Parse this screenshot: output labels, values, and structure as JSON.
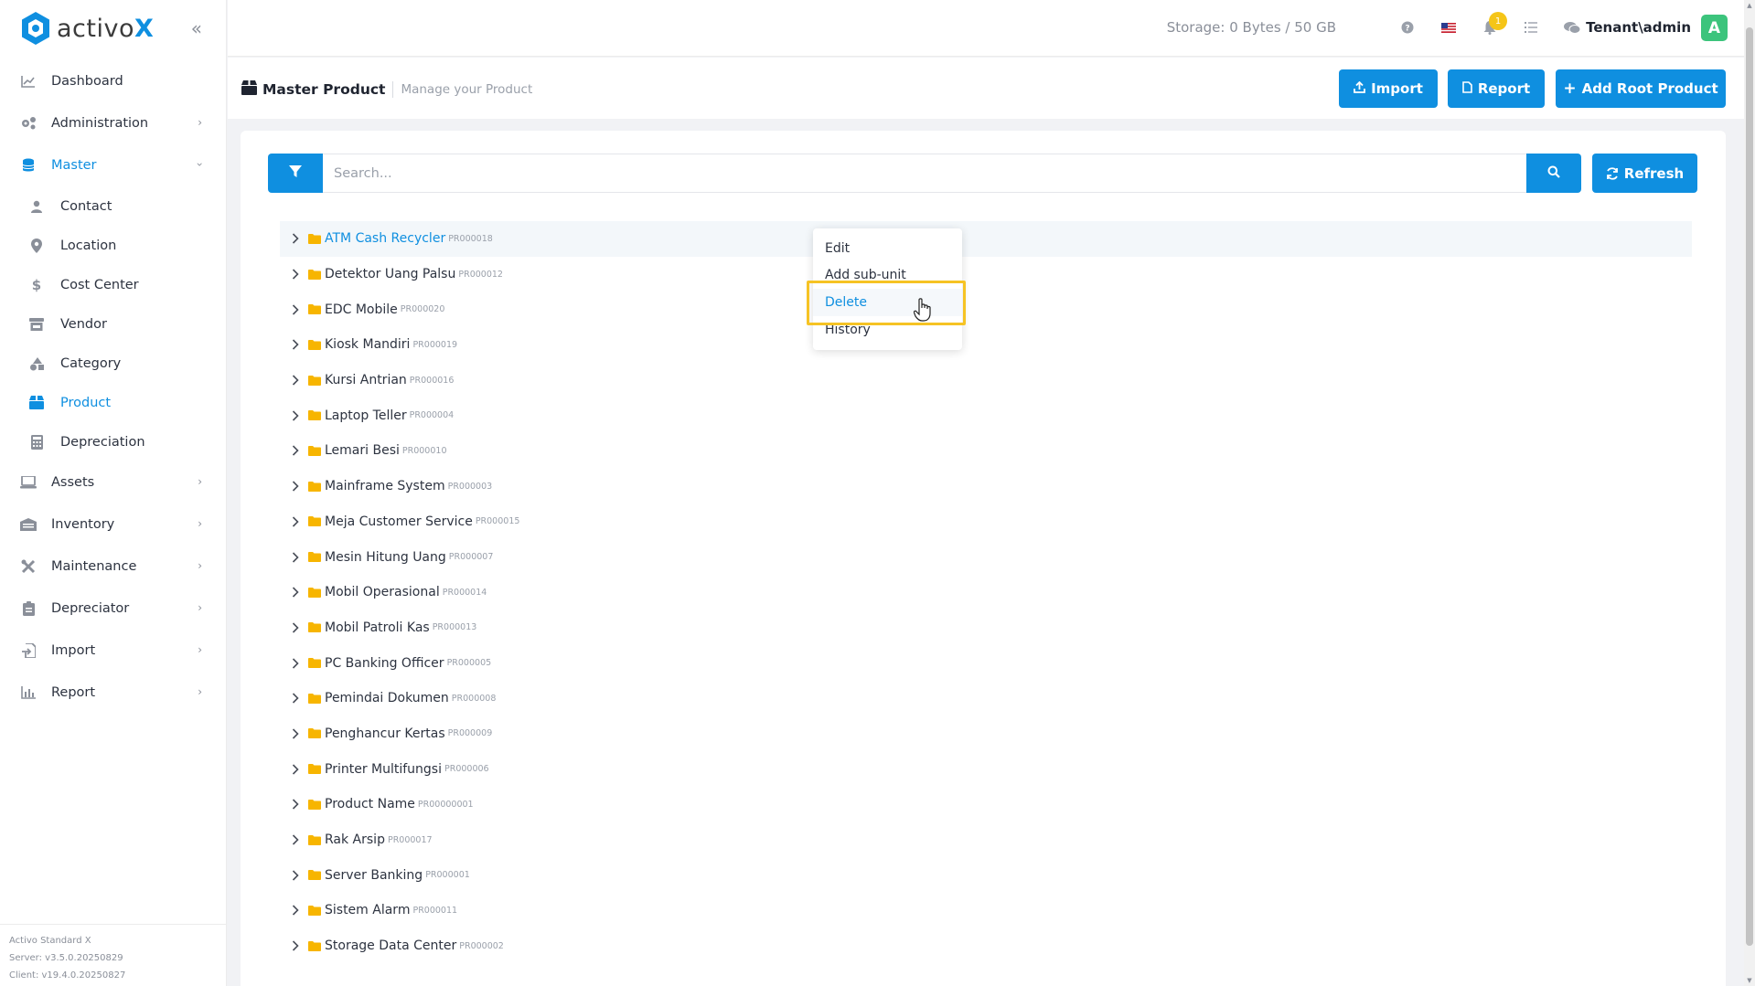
{
  "app": {
    "logo_prefix": "activo",
    "logo_suffix": "X"
  },
  "sidebar": {
    "items": [
      {
        "label": "Dashboard",
        "icon": "chart-line-icon",
        "has_chevron": false
      },
      {
        "label": "Administration",
        "icon": "gears-icon",
        "has_chevron": true
      },
      {
        "label": "Master",
        "icon": "database-icon",
        "has_chevron": true,
        "open": true
      }
    ],
    "sub_items": [
      {
        "label": "Contact",
        "icon": "user-icon"
      },
      {
        "label": "Location",
        "icon": "map-marker-icon"
      },
      {
        "label": "Cost Center",
        "icon": "dollar-icon"
      },
      {
        "label": "Vendor",
        "icon": "store-icon"
      },
      {
        "label": "Category",
        "icon": "shapes-icon"
      },
      {
        "label": "Product",
        "icon": "box-icon",
        "active": true
      },
      {
        "label": "Depreciation",
        "icon": "calculator-icon"
      }
    ],
    "bottom_items": [
      {
        "label": "Assets",
        "icon": "laptop-icon"
      },
      {
        "label": "Inventory",
        "icon": "warehouse-icon"
      },
      {
        "label": "Maintenance",
        "icon": "tools-icon"
      },
      {
        "label": "Depreciator",
        "icon": "clipboard-icon"
      },
      {
        "label": "Import",
        "icon": "file-import-icon"
      },
      {
        "label": "Report",
        "icon": "chart-bar-icon"
      }
    ],
    "footer": {
      "edition": "Activo Standard X",
      "server": "Server: v3.5.0.20250829",
      "client": "Client: v19.4.0.20250827"
    }
  },
  "topbar": {
    "storage": "Storage: 0 Bytes / 50 GB",
    "notification_count": "1",
    "user_name": "Tenant\\admin",
    "avatar_letter": "A"
  },
  "page_header": {
    "title": "Master Product",
    "subtitle": "Manage your Product",
    "import_label": "Import",
    "report_label": "Report",
    "add_root_label": "Add Root Product"
  },
  "search": {
    "placeholder": "Search...",
    "value": "",
    "refresh_label": "Refresh"
  },
  "tree": [
    {
      "name": "ATM Cash Recycler",
      "code": "PR000018"
    },
    {
      "name": "Detektor Uang Palsu",
      "code": "PR000012"
    },
    {
      "name": "EDC Mobile",
      "code": "PR000020"
    },
    {
      "name": "Kiosk Mandiri",
      "code": "PR000019"
    },
    {
      "name": "Kursi Antrian",
      "code": "PR000016"
    },
    {
      "name": "Laptop Teller",
      "code": "PR000004"
    },
    {
      "name": "Lemari Besi",
      "code": "PR000010"
    },
    {
      "name": "Mainframe System",
      "code": "PR000003"
    },
    {
      "name": "Meja Customer Service",
      "code": "PR000015"
    },
    {
      "name": "Mesin Hitung Uang",
      "code": "PR000007"
    },
    {
      "name": "Mobil Operasional",
      "code": "PR000014"
    },
    {
      "name": "Mobil Patroli Kas",
      "code": "PR000013"
    },
    {
      "name": "PC Banking Officer",
      "code": "PR000005"
    },
    {
      "name": "Pemindai Dokumen",
      "code": "PR000008"
    },
    {
      "name": "Penghancur Kertas",
      "code": "PR000009"
    },
    {
      "name": "Printer Multifungsi",
      "code": "PR000006"
    },
    {
      "name": "Product Name",
      "code": "PR00000001"
    },
    {
      "name": "Rak Arsip",
      "code": "PR000017"
    },
    {
      "name": "Server Banking",
      "code": "PR000001"
    },
    {
      "name": "Sistem Alarm",
      "code": "PR000011"
    },
    {
      "name": "Storage Data Center",
      "code": "PR000002"
    }
  ],
  "context_menu": {
    "items": [
      "Edit",
      "Add sub-unit",
      "Delete",
      "History"
    ],
    "focused": "Delete"
  },
  "colors": {
    "accent": "#0f8fe0",
    "highlight": "#f6c324",
    "avatar": "#3cc47c"
  }
}
